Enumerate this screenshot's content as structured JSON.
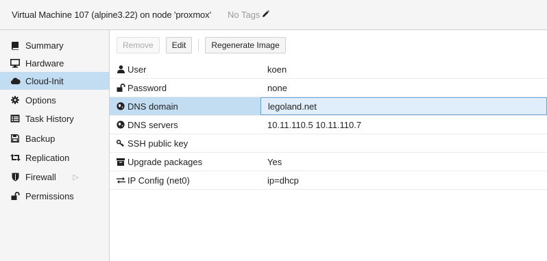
{
  "header": {
    "title": "Virtual Machine 107 (alpine3.22) on node 'proxmox'",
    "tags_label": "No Tags"
  },
  "sidebar": {
    "items": [
      {
        "label": "Summary",
        "icon": "book-icon"
      },
      {
        "label": "Hardware",
        "icon": "desktop-icon"
      },
      {
        "label": "Cloud-Init",
        "icon": "cloud-icon",
        "selected": true
      },
      {
        "label": "Options",
        "icon": "gear-icon"
      },
      {
        "label": "Task History",
        "icon": "list-alt-icon"
      },
      {
        "label": "Backup",
        "icon": "floppy-icon"
      },
      {
        "label": "Replication",
        "icon": "retweet-icon"
      },
      {
        "label": "Firewall",
        "icon": "shield-icon",
        "expand_arrow": "▷"
      },
      {
        "label": "Permissions",
        "icon": "unlock-icon"
      }
    ]
  },
  "toolbar": {
    "remove_label": "Remove",
    "edit_label": "Edit",
    "regenerate_label": "Regenerate Image"
  },
  "grid": {
    "rows": [
      {
        "key": "User",
        "value": "koen",
        "icon": "user-icon"
      },
      {
        "key": "Password",
        "value": "none",
        "icon": "unlock-icon"
      },
      {
        "key": "DNS domain",
        "value": "legoland.net",
        "icon": "globe-icon",
        "selected": true
      },
      {
        "key": "DNS servers",
        "value": "10.11.110.5 10.11.110.7",
        "icon": "globe-icon"
      },
      {
        "key": "SSH public key",
        "value": "",
        "icon": "key-icon"
      },
      {
        "key": "Upgrade packages",
        "value": "Yes",
        "icon": "archive-icon"
      },
      {
        "key": "IP Config (net0)",
        "value": "ip=dhcp",
        "icon": "exchange-icon"
      }
    ]
  },
  "colors": {
    "selection": "#c2ddf2",
    "panel_bg": "#f5f5f5",
    "border": "#cfcfcf"
  }
}
